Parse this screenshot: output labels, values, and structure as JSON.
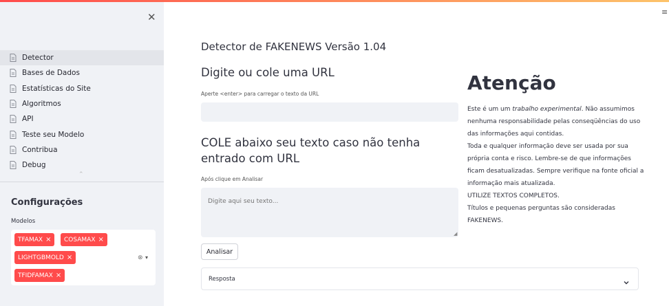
{
  "sidebar": {
    "close_icon": "close-icon",
    "items": [
      {
        "label": "Detector",
        "active": true
      },
      {
        "label": "Bases de Dados",
        "active": false
      },
      {
        "label": "Estatísticas do Site",
        "active": false
      },
      {
        "label": "Algoritmos",
        "active": false
      },
      {
        "label": "API",
        "active": false
      },
      {
        "label": "Teste seu Modelo",
        "active": false
      },
      {
        "label": "Contribua",
        "active": false
      },
      {
        "label": "Debug",
        "active": false
      }
    ],
    "config_title": "Configurações",
    "models_label": "Modelos",
    "selected_models": [
      "TFAMAX",
      "COSAMAX",
      "LIGHTGBMOLD",
      "TFIDFAMAX"
    ],
    "tag_remove": "×"
  },
  "main": {
    "title": "Detector de FAKENEWS Versão 1.04",
    "url_heading": "Digite ou cole uma URL",
    "url_hint": "Aperte <enter> para carregar o texto da URL",
    "url_value": "",
    "paste_heading": "COLE abaixo seu texto caso não tenha entrado com URL",
    "text_hint": "Após clique em Analisar",
    "text_placeholder": "Digite aqui seu texto...",
    "analyze_button": "Analisar",
    "response_label": "Resposta"
  },
  "attention": {
    "title": "Atenção",
    "line1_prefix": "Este é um um ",
    "line1_italic": "trabalho experimental",
    "line1_suffix": ". Não assumimos nenhuma responsabilidade pelas conseqüências do uso das informações aqui contidas.",
    "line2": "Toda e qualquer informação deve ser usada por sua própria conta e risco. Lembre-se de que informações ficam desatualizadas. Sempre verifique na fonte oficial a informação mais atualizada.",
    "line3": "UTILIZE TEXTOS COMPLETOS.",
    "line4": "Títulos e pequenas perguntas são consideradas FAKENEWS."
  },
  "colors": {
    "accent": "#ff4b4b",
    "sidebar_bg": "#f0f2f6",
    "text": "#31333f"
  },
  "icons": {
    "nav_item": "file-icon",
    "menu": "hamburger-icon",
    "expander": "chevron-down-icon"
  }
}
